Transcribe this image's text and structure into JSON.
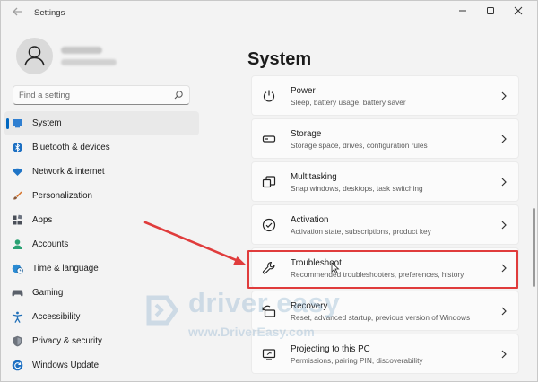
{
  "window": {
    "title": "Settings"
  },
  "search": {
    "placeholder": "Find a setting"
  },
  "sidebar": {
    "items": [
      {
        "label": "System",
        "icon": "system-icon",
        "selected": true
      },
      {
        "label": "Bluetooth & devices",
        "icon": "bluetooth-icon"
      },
      {
        "label": "Network & internet",
        "icon": "wifi-icon"
      },
      {
        "label": "Personalization",
        "icon": "brush-icon"
      },
      {
        "label": "Apps",
        "icon": "apps-icon"
      },
      {
        "label": "Accounts",
        "icon": "accounts-icon"
      },
      {
        "label": "Time & language",
        "icon": "globe-clock-icon"
      },
      {
        "label": "Gaming",
        "icon": "gamepad-icon"
      },
      {
        "label": "Accessibility",
        "icon": "accessibility-icon"
      },
      {
        "label": "Privacy & security",
        "icon": "shield-icon"
      },
      {
        "label": "Windows Update",
        "icon": "update-icon"
      }
    ]
  },
  "main": {
    "title": "System",
    "cards": [
      {
        "title": "Power",
        "desc": "Sleep, battery usage, battery saver",
        "icon": "power-icon"
      },
      {
        "title": "Storage",
        "desc": "Storage space, drives, configuration rules",
        "icon": "storage-icon"
      },
      {
        "title": "Multitasking",
        "desc": "Snap windows, desktops, task switching",
        "icon": "multitasking-icon"
      },
      {
        "title": "Activation",
        "desc": "Activation state, subscriptions, product key",
        "icon": "activation-icon"
      },
      {
        "title": "Troubleshoot",
        "desc": "Recommended troubleshooters, preferences, history",
        "icon": "wrench-icon"
      },
      {
        "title": "Recovery",
        "desc": "Reset, advanced startup, previous version of Windows",
        "icon": "recovery-icon"
      },
      {
        "title": "Projecting to this PC",
        "desc": "Permissions, pairing PIN, discoverability",
        "icon": "projecting-icon"
      }
    ]
  },
  "watermark": {
    "brand": "driver easy",
    "url": "www.DriverEasy.com"
  },
  "colors": {
    "accent": "#0067c0",
    "highlight": "#e03c3c"
  }
}
